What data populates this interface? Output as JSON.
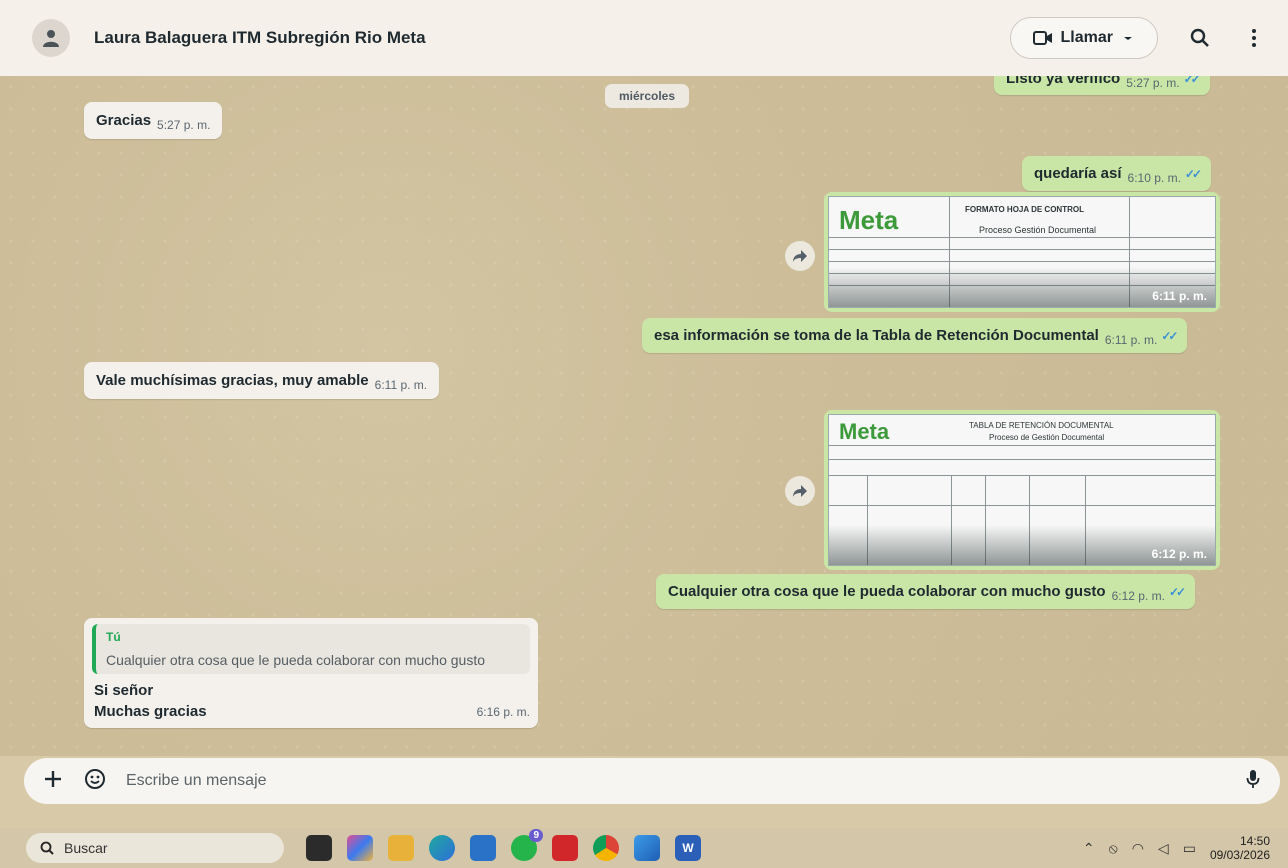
{
  "header": {
    "contact_name": "Laura Balaguera ITM Subregión Rio Meta",
    "call_label": "Llamar"
  },
  "chat": {
    "date_separator": "miércoles",
    "messages": [
      {
        "text": "Listo ya verifico",
        "time": "5:27 p. m."
      },
      {
        "text": "Gracias",
        "time": "5:27 p. m."
      },
      {
        "text": "quedaría así",
        "time": "6:10 p. m."
      },
      {
        "image_title": "FORMATO HOJA DE CONTROL",
        "image_subtitle": "Proceso Gestión Documental",
        "time": "6:11 p. m."
      },
      {
        "text": "esa información se toma de la Tabla de Retención Documental",
        "time": "6:11 p. m."
      },
      {
        "text": "Vale muchísimas gracias, muy amable",
        "time": "6:11 p. m."
      },
      {
        "image_title": "TABLA DE RETENCIÓN DOCUMENTAL",
        "image_subtitle": "Proceso de Gestión Documental",
        "time": "6:12 p. m."
      },
      {
        "text": "Cualquier otra cosa que le pueda colaborar con mucho gusto",
        "time": "6:12 p. m."
      },
      {
        "quote_author": "Tú",
        "quote_text": "Cualquier otra cosa que le pueda colaborar con mucho gusto",
        "line1": "Si señor",
        "line2": "Muchas gracias",
        "time": "6:16 p. m."
      }
    ],
    "doc_logo": "Meta"
  },
  "composer": {
    "placeholder": "Escribe un mensaje"
  },
  "taskbar": {
    "search_label": "Buscar",
    "time": "14:50",
    "date": "09/03/2026",
    "whatsapp_badge": "9"
  },
  "colors": {
    "outgoing": "#c9e6a6",
    "incoming": "#f4f1ec",
    "ticks": "#3d8fd6",
    "quote_accent": "#1fa855"
  },
  "icons": [
    "person-icon",
    "video-icon",
    "chevron-down-icon",
    "search-icon",
    "menu-dots-icon",
    "forward-icon",
    "plus-icon",
    "sticker-icon",
    "mic-icon"
  ]
}
